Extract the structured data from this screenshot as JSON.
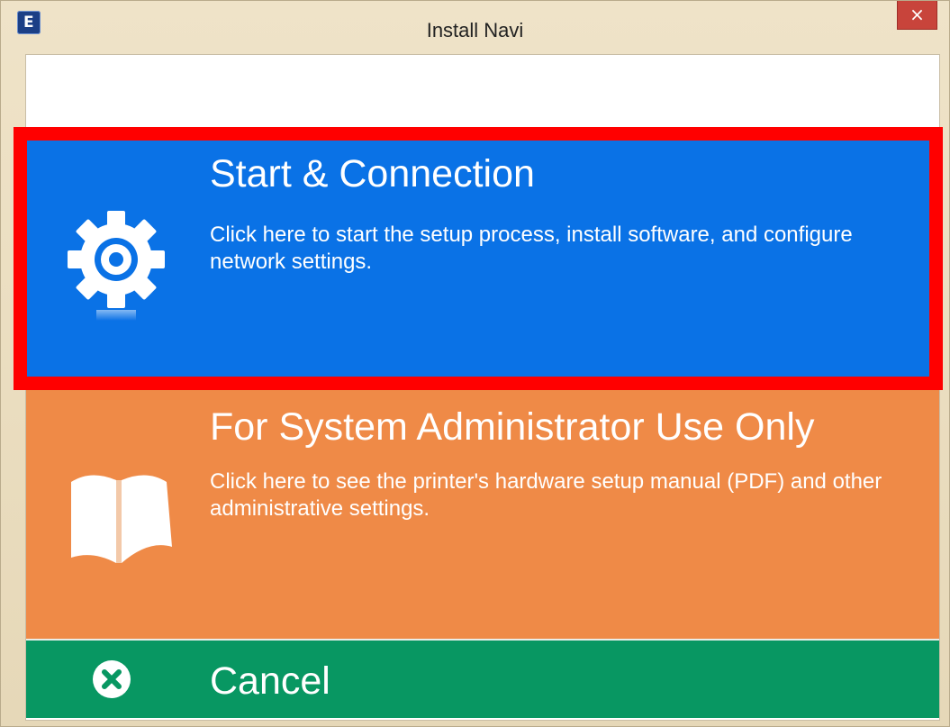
{
  "window": {
    "title": "Install Navi",
    "app_icon_letter": "E",
    "close_glyph": "×"
  },
  "tiles": {
    "start": {
      "title": "Start & Connection",
      "description": "Click here to start the setup process, install software, and configure network settings.",
      "icon": "gear-icon",
      "color": "#0a72e6",
      "highlighted": true,
      "highlight_color": "#ff0000"
    },
    "admin": {
      "title": "For System Administrator Use Only",
      "description": "Click here to see the printer's hardware setup manual (PDF) and other administrative settings.",
      "icon": "book-icon",
      "color": "#ef8a47"
    },
    "cancel": {
      "title": "Cancel",
      "icon": "x-circle-icon",
      "color": "#089762"
    }
  }
}
